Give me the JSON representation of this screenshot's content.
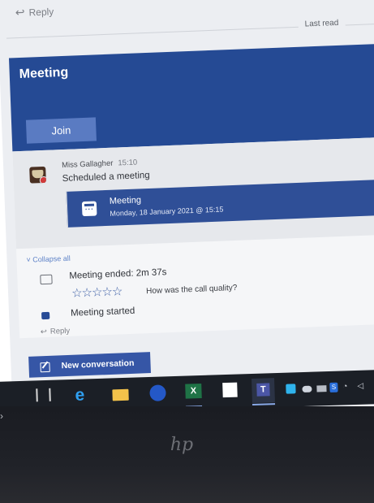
{
  "thread": {
    "reply_top": "Reply",
    "last_read": "Last read"
  },
  "meeting_card": {
    "title": "Meeting",
    "join_label": "Join"
  },
  "message": {
    "sender": "Miss Gallagher",
    "time": "15:10",
    "text": "Scheduled a meeting",
    "meeting_title": "Meeting",
    "meeting_date": "Monday, 18 January 2021 @ 15:15"
  },
  "activity": {
    "collapse_label": "Collapse all",
    "ended": "Meeting ended: 2m 37s",
    "stars": "☆☆☆☆☆",
    "quality_question": "How was the call quality?",
    "started": "Meeting started",
    "reply_bottom": "Reply"
  },
  "compose": {
    "new_conversation": "New conversation"
  },
  "laptop": {
    "brand": "hp"
  },
  "icons": {
    "reply": "reply-arrow-icon",
    "calendar": "calendar-icon",
    "video_outline": "video-camera-outline-icon",
    "video_solid": "video-camera-icon",
    "edit": "edit-icon"
  },
  "colors": {
    "banner": "#254a94",
    "accent": "#2f4f97",
    "button": "#3656a6",
    "taskbar": "#1b1f26"
  }
}
